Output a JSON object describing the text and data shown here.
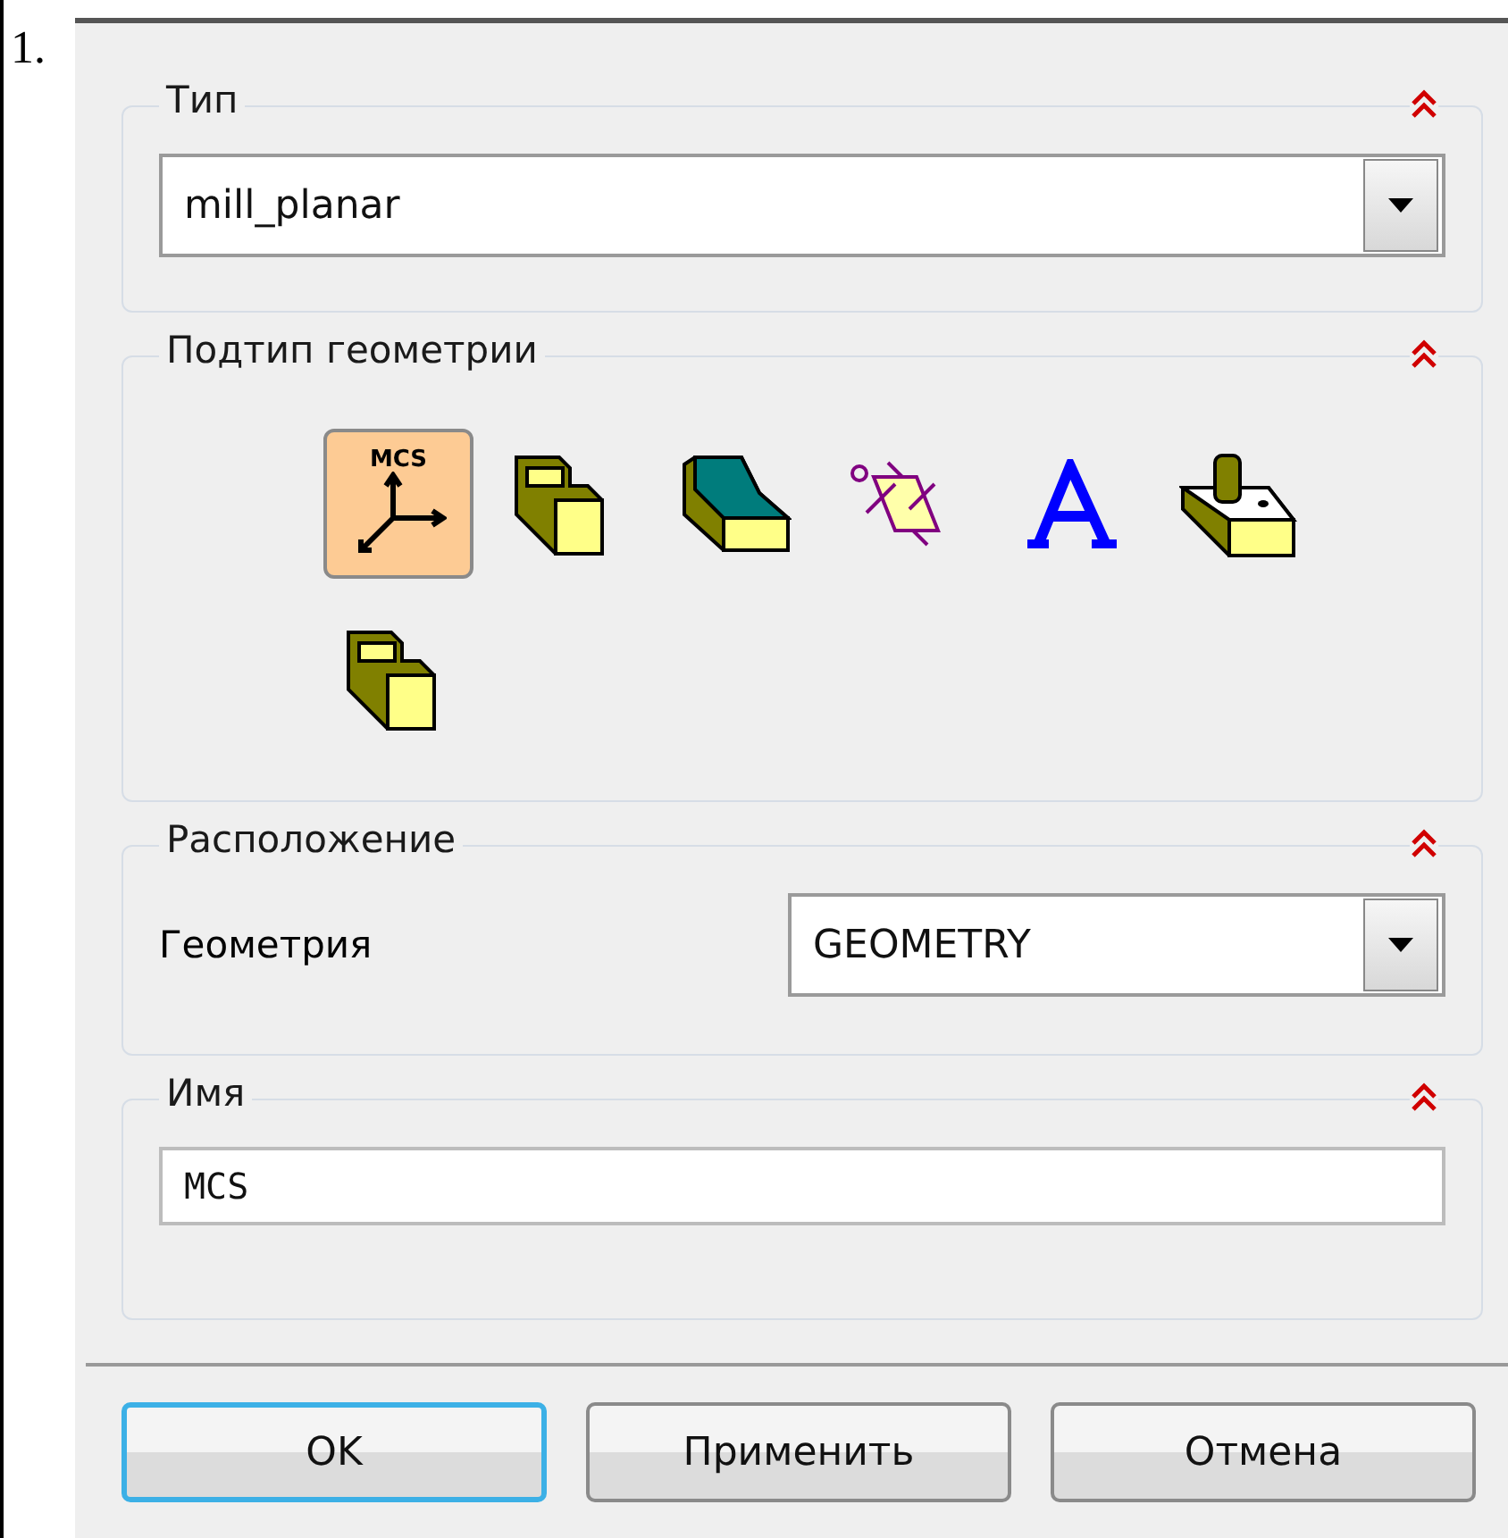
{
  "list_marker": "1.",
  "groups": [
    {
      "title": "Тип",
      "kind": "dropdown",
      "value": "mill_planar"
    },
    {
      "title": "Подтип геометрии",
      "kind": "icons",
      "icons": [
        {
          "kind": "mcs",
          "label": "MCS",
          "selected": true
        },
        {
          "kind": "workpiece",
          "selected": false
        },
        {
          "kind": "surface",
          "selected": false
        },
        {
          "kind": "plane",
          "selected": false
        },
        {
          "kind": "text",
          "selected": false
        },
        {
          "kind": "boss",
          "selected": false
        },
        {
          "kind": "workpiece",
          "selected": false
        }
      ]
    },
    {
      "title": "Расположение",
      "kind": "labeled_dropdown",
      "label": "Геометрия",
      "value": "GEOMETRY"
    },
    {
      "title": "Имя",
      "kind": "text_field",
      "value": "MCS"
    }
  ],
  "buttons": [
    {
      "label": "OK",
      "focused": true
    },
    {
      "label": "Применить",
      "focused": false
    },
    {
      "label": "Отмена",
      "focused": false
    }
  ]
}
